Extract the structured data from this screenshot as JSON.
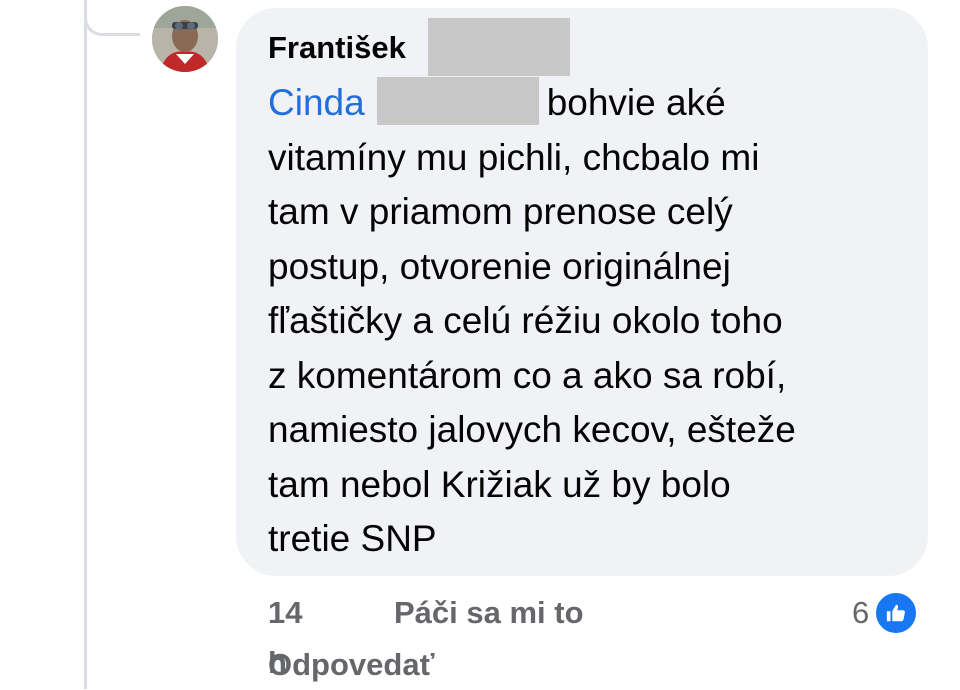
{
  "comment": {
    "author_name": "František",
    "mention_name": "Cinda",
    "lines": [
      "bohvie aké",
      "vitamíny mu pichli, chcbalo mi",
      "tam v priamom prenose celý",
      "postup, otvorenie originálnej",
      "fľaštičky a celú réžiu okolo toho",
      "z komentárom co a ako sa robí,",
      "namiesto jalovych kecov, ešteže",
      "tam nebol Križiak už by bolo",
      "tretie SNP"
    ],
    "avatar_icon": "profile-photo-icon"
  },
  "actions": {
    "time": "14 h",
    "like_label": "Páči sa mi to",
    "reply_label": "Odpovedať"
  },
  "reactions": {
    "count": "6",
    "icon": "like-thumb-icon",
    "color": "#1877f2"
  },
  "colors": {
    "bubble": "#f0f2f5",
    "mention": "#216fdb",
    "meta_text": "#65676b",
    "thread_line": "#dadde1",
    "redaction": "#c8c8c8"
  }
}
